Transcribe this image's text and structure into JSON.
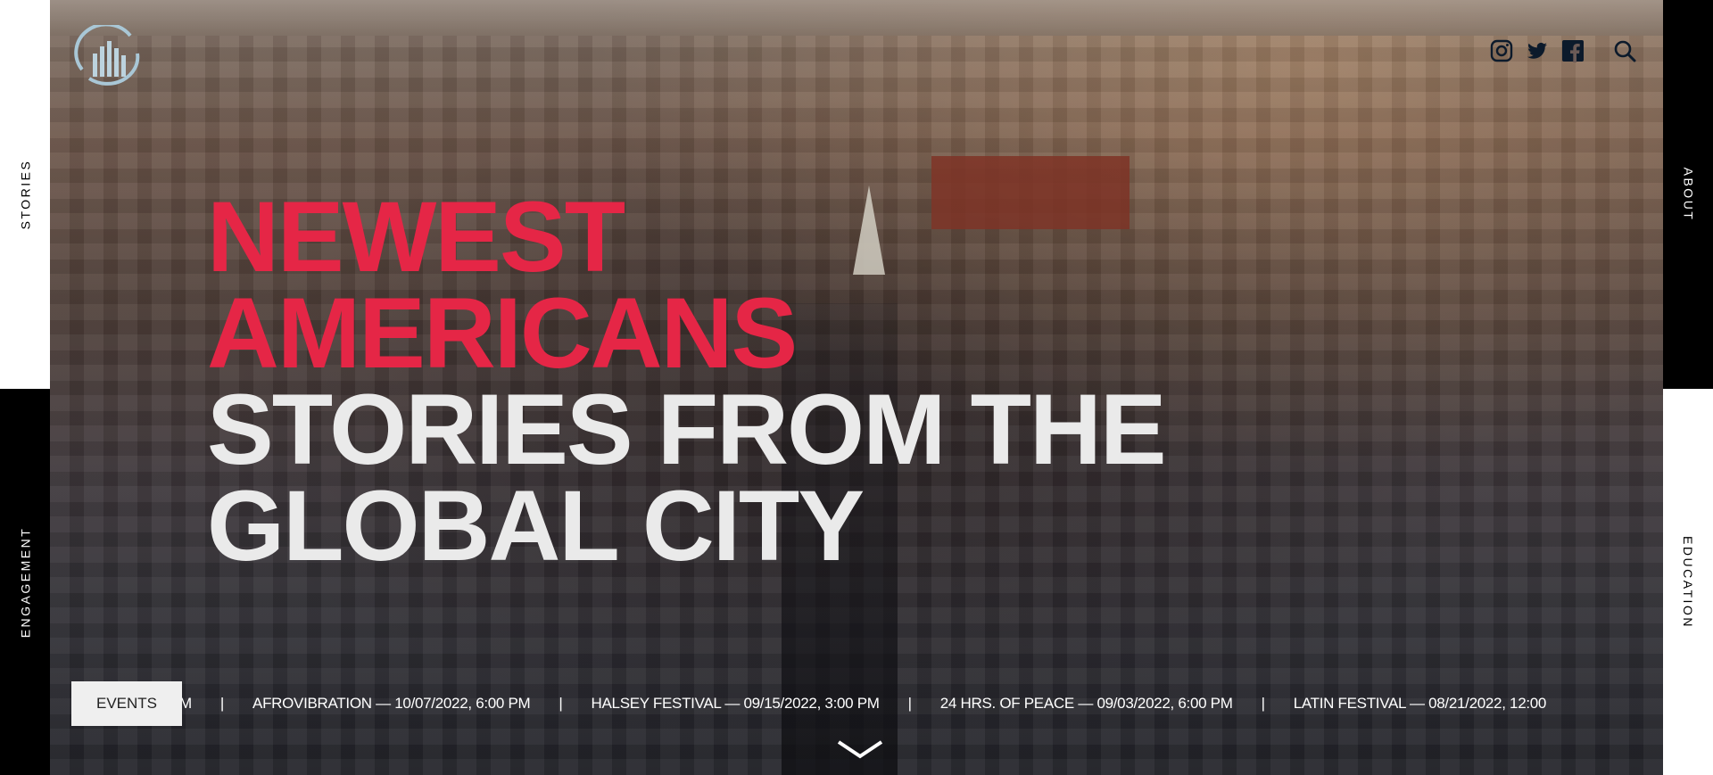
{
  "nav": {
    "stories": "STORIES",
    "engagement": "ENGAGEMENT",
    "about": "ABOUT",
    "education": "EDUCATION"
  },
  "hero": {
    "title_red_1": "NEWEST",
    "title_red_2": "AMERICANS",
    "title_light_1": "STORIES FROM THE",
    "title_light_2": "GLOBAL CITY"
  },
  "social_icons": [
    "instagram-icon",
    "twitter-icon",
    "facebook-icon",
    "search-icon"
  ],
  "events": {
    "button_label": "EVENTS",
    "separator": "|",
    "items": [
      "PM",
      "AFROVIBRATION — 10/07/2022, 6:00 PM",
      "HALSEY FESTIVAL — 09/15/2022, 3:00 PM",
      "24 HRS. OF PEACE — 09/03/2022, 6:00 PM",
      "LATIN FESTIVAL — 08/21/2022, 12:00"
    ]
  },
  "colors": {
    "accent_red": "#e52646",
    "title_light": "#eaeaea",
    "sidebar_black": "#000000",
    "sidebar_white": "#ffffff"
  }
}
